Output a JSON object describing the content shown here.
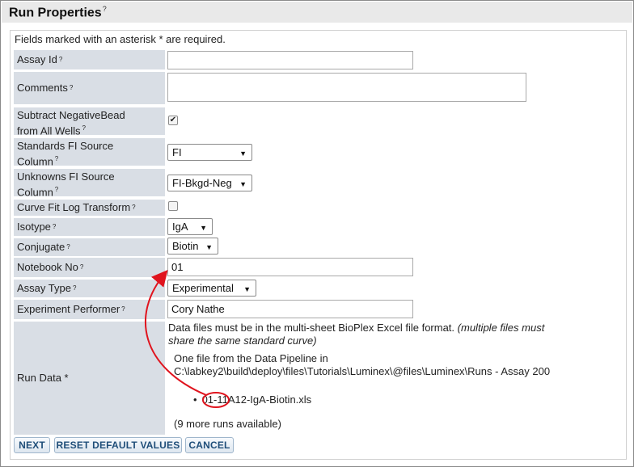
{
  "panel": {
    "title": "Run Properties",
    "help": "?"
  },
  "required_note": "Fields marked with an asterisk * are required.",
  "fields": {
    "assay_id": {
      "label": "Assay Id",
      "value": ""
    },
    "comments": {
      "label": "Comments",
      "value": ""
    },
    "subtract_bead_1": "Subtract NegativeBead",
    "subtract_bead_2": "from All Wells",
    "subtract_bead_checked": "✔",
    "standards_1": "Standards FI Source",
    "standards_2": "Column",
    "standards_value": "FI",
    "unknowns_1": "Unknowns FI Source",
    "unknowns_2": "Column",
    "unknowns_value": "FI-Bkgd-Neg",
    "curve_fit": "Curve Fit Log Transform",
    "isotype": {
      "label": "Isotype",
      "value": "IgA"
    },
    "conjugate": {
      "label": "Conjugate",
      "value": "Biotin"
    },
    "notebook": {
      "label": "Notebook No",
      "value": "01"
    },
    "assay_type": {
      "label": "Assay Type",
      "value": "Experimental"
    },
    "performer": {
      "label": "Experiment Performer",
      "value": "Cory Nathe"
    },
    "run_data": {
      "label": "Run Data *"
    }
  },
  "run_data": {
    "format_note": "Data files must be in the multi-sheet BioPlex Excel file format.",
    "format_note_italic_1": "(multiple files must",
    "format_note_italic_2": "share the same standard curve)",
    "pipeline_1": "One file from the Data Pipeline in",
    "pipeline_2": "C:\\labkey2\\build\\deploy\\files\\Tutorials\\Luminex\\@files\\Luminex\\Runs - Assay 200",
    "file": "01-11A12-IgA-Biotin.xls",
    "more_runs": "(9 more runs available)"
  },
  "buttons": {
    "next": "NEXT",
    "reset": "RESET DEFAULT VALUES",
    "cancel": "CANCEL"
  },
  "colors": {
    "label_bg": "#d9dee5",
    "button_text": "#1f4e79",
    "annotation": "#e0141e"
  },
  "icons": {
    "select_arrow": "▼",
    "bullet": "•"
  }
}
